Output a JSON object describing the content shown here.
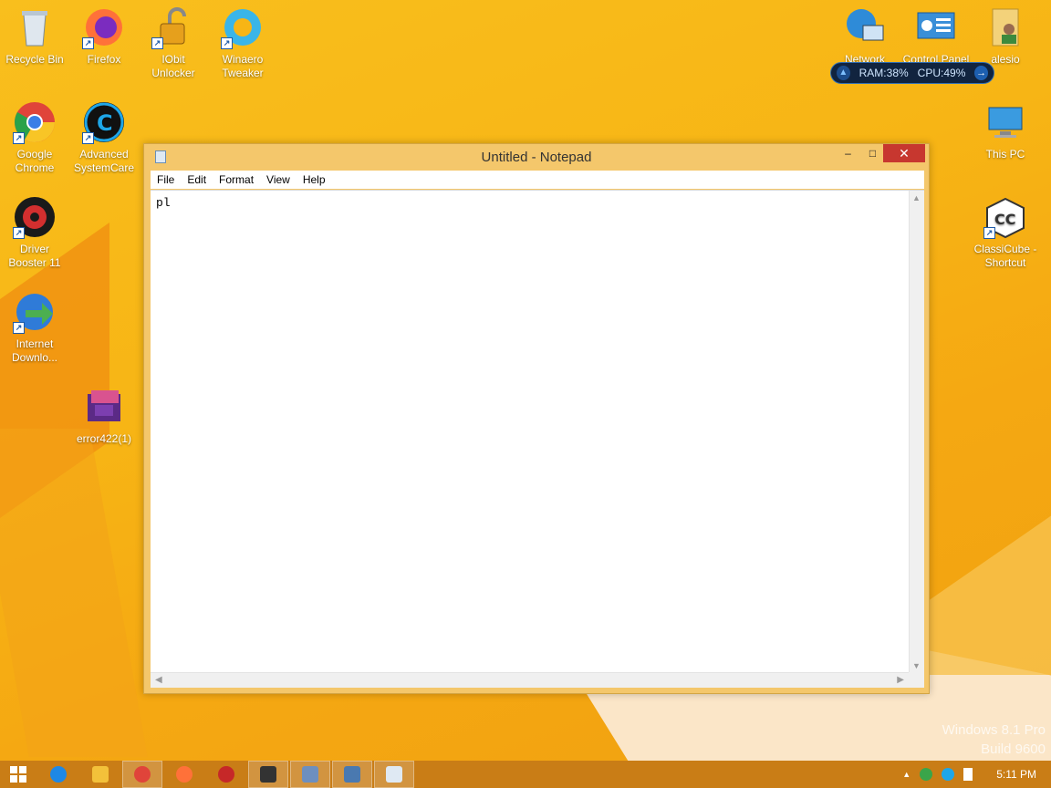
{
  "desktop": {
    "icons_left": [
      {
        "label": "Recycle Bin",
        "icon": "recycle-bin-icon"
      },
      {
        "label": "Firefox",
        "icon": "firefox-icon"
      },
      {
        "label": "IObit Unlocker",
        "icon": "unlocker-icon"
      },
      {
        "label": "Winaero Tweaker",
        "icon": "winaero-icon"
      },
      {
        "label": "Google Chrome",
        "icon": "chrome-icon"
      },
      {
        "label": "Advanced SystemCare",
        "icon": "systemcare-icon"
      },
      {
        "label": "Driver Booster 11",
        "icon": "driver-booster-icon"
      },
      {
        "label": "Internet Downlo...",
        "icon": "idm-icon"
      },
      {
        "label": "error422(1)",
        "icon": "image-file-icon"
      }
    ],
    "icons_right": [
      {
        "label": "Network",
        "icon": "network-icon"
      },
      {
        "label": "Control Panel",
        "icon": "control-panel-icon"
      },
      {
        "label": "alesio",
        "icon": "user-folder-icon"
      },
      {
        "label": "This PC",
        "icon": "this-pc-icon"
      },
      {
        "label": "ClassiCube - Shortcut",
        "icon": "classicube-icon"
      }
    ],
    "widget": {
      "ram": "RAM:38%",
      "cpu": "CPU:49%"
    },
    "watermark": {
      "line1": "Windows 8.1 Pro",
      "line2": "Build 9600"
    }
  },
  "notepad": {
    "title": "Untitled - Notepad",
    "menu": [
      "File",
      "Edit",
      "Format",
      "View",
      "Help"
    ],
    "content": "pl",
    "controls": {
      "minimize": "–",
      "maximize": "□",
      "close": "✕"
    }
  },
  "taskbar": {
    "items": [
      {
        "name": "internet-explorer",
        "color": "#1e88e5"
      },
      {
        "name": "file-explorer",
        "color": "#f3c13a"
      },
      {
        "name": "chrome",
        "color": "#e0443a"
      },
      {
        "name": "firefox",
        "color": "#ff7139"
      },
      {
        "name": "driver-booster",
        "color": "#c62828"
      },
      {
        "name": "7zip",
        "color": "#333333"
      },
      {
        "name": "installer",
        "color": "#6d8fbf"
      },
      {
        "name": "java",
        "color": "#4a79b0"
      },
      {
        "name": "notepad",
        "color": "#dfe9f3"
      }
    ],
    "clock": "5:11 PM",
    "tray_up": "▲"
  },
  "colors": {
    "wallpaper": "#f7b515",
    "taskbar": "#c97d16",
    "window_frame": "#f4c76b",
    "close_button": "#c7372f"
  }
}
